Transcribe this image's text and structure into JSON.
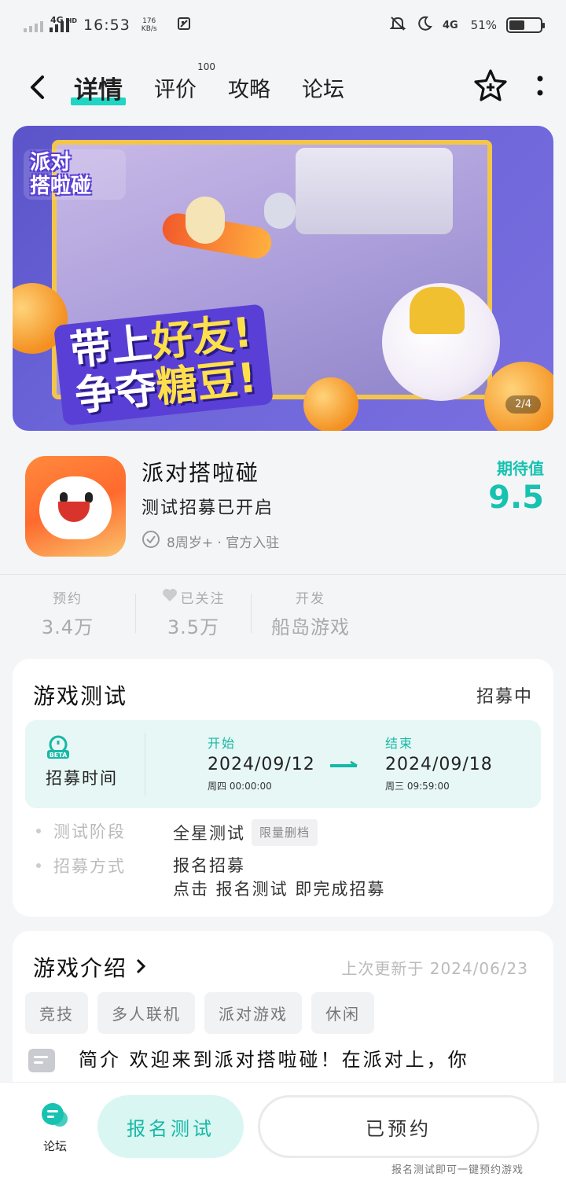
{
  "status_bar": {
    "network": "4G",
    "network_sup": "HD",
    "time": "16:53",
    "rate_value": "176",
    "rate_unit": "KB/s",
    "network2": "4G",
    "battery": "51%",
    "battery_level": 0.51
  },
  "nav": {
    "tabs": [
      {
        "label": "详情"
      },
      {
        "label": "评价",
        "badge": "100"
      },
      {
        "label": "攻略"
      },
      {
        "label": "论坛"
      }
    ]
  },
  "banner": {
    "logo_line1": "派对",
    "logo_line2": "搭啦碰",
    "slogan_part1": "带上",
    "slogan_part2": "好友!",
    "slogan_part3": "争夺",
    "slogan_part4": "糖豆!",
    "counter": "2/4"
  },
  "app": {
    "name": "派对搭啦碰",
    "subtitle": "测试招募已开启",
    "meta": "8周岁+ · 官方入驻",
    "expect_label": "期待值",
    "expect_value": "9.5"
  },
  "stats": [
    {
      "label": "预约",
      "value": "3.4万"
    },
    {
      "label": "已关注",
      "value": "3.5万"
    },
    {
      "label": "开发",
      "value": "船岛游戏"
    }
  ],
  "test_card": {
    "title": "游戏测试",
    "status": "招募中",
    "time_label": "招募时间",
    "start_label": "开始",
    "start_date": "2024/09/12",
    "start_detail": "周四 00:00:00",
    "end_label": "结束",
    "end_date": "2024/09/18",
    "end_detail": "周三 09:59:00",
    "stage_key": "测试阶段",
    "stage_value": "全星测试",
    "stage_tag": "限量删档",
    "method_key": "招募方式",
    "method_value": "报名招募",
    "method_desc": "点击 报名测试 即完成招募"
  },
  "intro_card": {
    "title": "游戏介绍",
    "updated": "上次更新于 2024/06/23",
    "tags": [
      "竞技",
      "多人联机",
      "派对游戏",
      "休闲"
    ],
    "text": "简介 欢迎来到派对搭啦碰！在派对上，你"
  },
  "bottom": {
    "forum_label": "论坛",
    "signup_label": "报名测试",
    "reserved_label": "已预约",
    "hint": "报名测试即可一键预约游戏"
  },
  "colors": {
    "accent": "#17c2b0",
    "tab_underline": "#1fd6c4",
    "page_bg": "#f4f5f7"
  }
}
